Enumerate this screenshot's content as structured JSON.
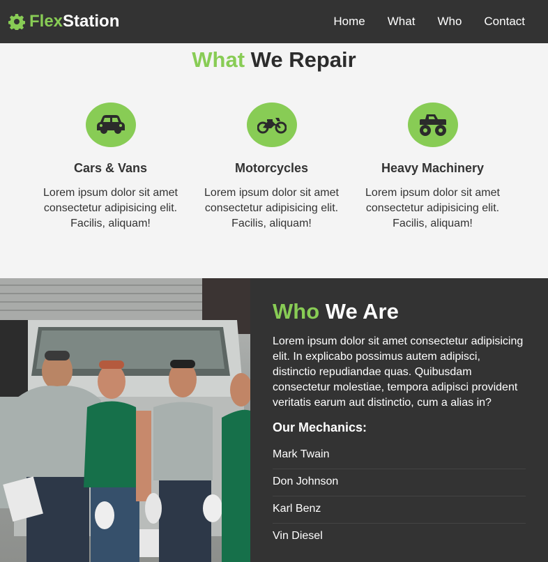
{
  "navbar": {
    "brand_accent": "Flex",
    "brand_rest": "Station",
    "brand_icon": "gear-icon",
    "links": [
      "Home",
      "What",
      "Who",
      "Contact"
    ]
  },
  "repair": {
    "title_accent": "What",
    "title_rest": " We Repair",
    "services": [
      {
        "icon": "car-icon",
        "title": "Cars & Vans",
        "desc": "Lorem ipsum dolor sit amet consectetur adipisicing elit. Facilis, aliquam!"
      },
      {
        "icon": "motorcycle-icon",
        "title": "Motorcycles",
        "desc": "Lorem ipsum dolor sit amet consectetur adipisicing elit. Facilis, aliquam!"
      },
      {
        "icon": "monster-truck-icon",
        "title": "Heavy Machinery",
        "desc": "Lorem ipsum dolor sit amet consectetur adipisicing elit. Facilis, aliquam!"
      }
    ]
  },
  "who": {
    "title_accent": "Who",
    "title_rest": " We Are",
    "desc": "Lorem ipsum dolor sit amet consectetur adipisicing elit. In explicabo possimus autem adipisci, distinctio repudiandae quas. Quibusdam consectetur molestiae, tempora adipisci provident veritatis earum aut distinctio, cum a alias in?",
    "mechanics_heading": "Our Mechanics:",
    "mechanics": [
      "Mark Twain",
      "Don Johnson",
      "Karl Benz",
      "Vin Diesel"
    ]
  },
  "colors": {
    "accent": "#88cc55",
    "dark": "#333333",
    "light_bg": "#f4f4f4"
  }
}
